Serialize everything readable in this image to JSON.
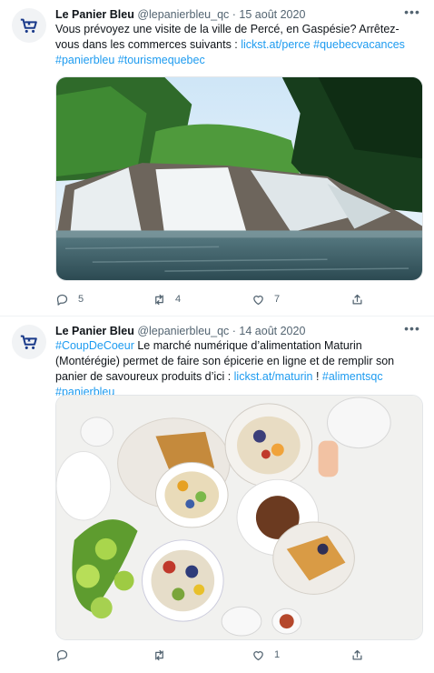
{
  "tweets": [
    {
      "author": "Le Panier Bleu",
      "handle": "@lepanierbleu_qc",
      "separator": "·",
      "date": "15 août 2020",
      "text_before": "Vous prévoyez une visite de la ville de Percé, en Gaspésie? Arrêtez-vous dans les commerces suivants : ",
      "link": "lickst.at/perce",
      "hashtags_line": "#quebecvacances",
      "hashtags_line2": "#panierbleu #tourismequebec",
      "media_alt": "waterfall photo",
      "counts": {
        "reply": "5",
        "retweet": "4",
        "like": "7"
      }
    },
    {
      "author": "Le Panier Bleu",
      "handle": "@lepanierbleu_qc",
      "separator": "·",
      "date": "14 août 2020",
      "hashtag_lead": "#CoupDeCoeur",
      "text_main": " Le marché numérique d’alimentation Maturin (Montérégie) permet de faire son épicerie en ligne et de remplir son panier de savoureux produits d’ici : ",
      "link": "lickst.at/maturin",
      "text_mid": " ! ",
      "hashtags": "#alimentsqc #panierbleu",
      "media_alt": "breakfast food photo",
      "counts": {
        "reply": "",
        "retweet": "",
        "like": "1"
      }
    }
  ],
  "icons": [
    "reply-icon",
    "retweet-icon",
    "like-icon",
    "share-icon",
    "more-icon",
    "cart-logo-icon"
  ],
  "colors": {
    "link": "#1d9bf0",
    "brand_blue": "#1a3a8a",
    "muted": "#536471"
  }
}
